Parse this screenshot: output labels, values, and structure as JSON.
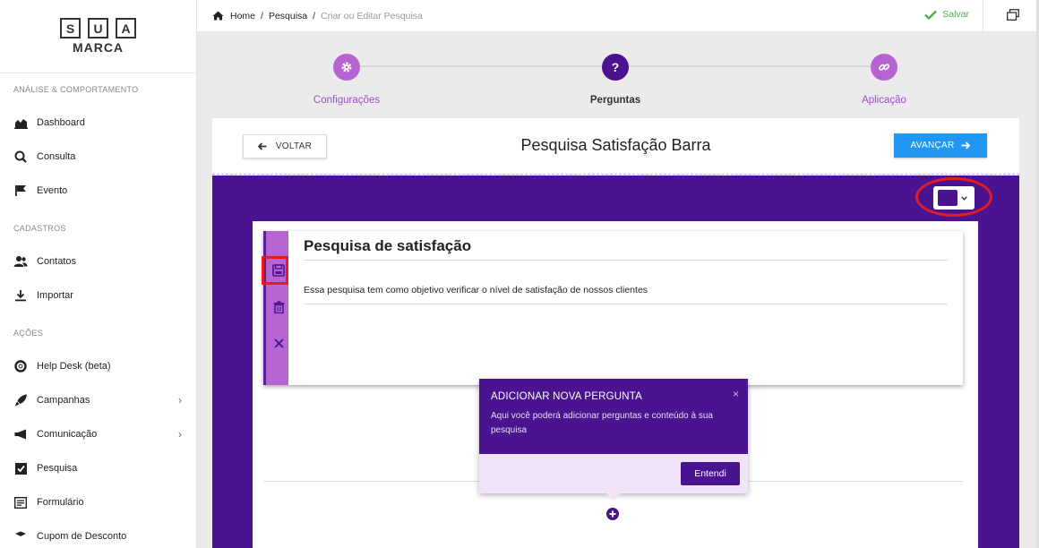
{
  "brand": {
    "letters": [
      "S",
      "U",
      "A"
    ],
    "sub": "MARCA"
  },
  "sidebar": {
    "sections": [
      {
        "title": "ANÁLISE & COMPORTAMENTO",
        "items": [
          {
            "label": "Dashboard",
            "icon": "chart-area-icon"
          },
          {
            "label": "Consulta",
            "icon": "search-icon"
          },
          {
            "label": "Evento",
            "icon": "flag-icon"
          }
        ]
      },
      {
        "title": "CADASTROS",
        "items": [
          {
            "label": "Contatos",
            "icon": "contacts-icon"
          },
          {
            "label": "Importar",
            "icon": "download-icon"
          }
        ]
      },
      {
        "title": "AÇÕES",
        "items": [
          {
            "label": "Help Desk (beta)",
            "icon": "lifebuoy-icon"
          },
          {
            "label": "Campanhas",
            "icon": "rocket-icon",
            "chevron": "›"
          },
          {
            "label": "Comunicação",
            "icon": "megaphone-icon",
            "chevron": "›"
          },
          {
            "label": "Pesquisa",
            "icon": "checkbox-icon"
          },
          {
            "label": "Formulário",
            "icon": "form-icon"
          },
          {
            "label": "Cupom de Desconto",
            "icon": "coupon-icon"
          }
        ]
      }
    ]
  },
  "topbar": {
    "breadcrumb": [
      "Home",
      "Pesquisa",
      "Criar ou Editar Pesquisa"
    ],
    "breadcrumb_sep": "/",
    "save_label": "Salvar"
  },
  "stepper": {
    "steps": [
      {
        "label": "Configurações",
        "icon": "gear-icon",
        "active": false
      },
      {
        "label": "Perguntas",
        "icon": "question-icon",
        "glyph": "?",
        "active": true
      },
      {
        "label": "Aplicação",
        "icon": "link-icon",
        "active": false
      }
    ]
  },
  "card": {
    "back_label": "VOLTAR",
    "title": "Pesquisa Satisfação Barra",
    "next_label": "AVANÇAR"
  },
  "survey": {
    "title": "Pesquisa de satisfação",
    "description": "Essa pesquisa tem como objetivo verificar o nível de satisfação de nossos clientes"
  },
  "tooltip": {
    "title": "ADICIONAR NOVA PERGUNTA",
    "text": "Aqui você poderá adicionar perguntas e conteúdo à sua pesquisa",
    "close": "×",
    "button": "Entendi"
  },
  "colors": {
    "primary": "#4a138f",
    "accent": "#b764d3",
    "step": "#9c4fc9",
    "blue": "#2196f3",
    "success": "#4caf50",
    "highlight": "#e41b23"
  }
}
